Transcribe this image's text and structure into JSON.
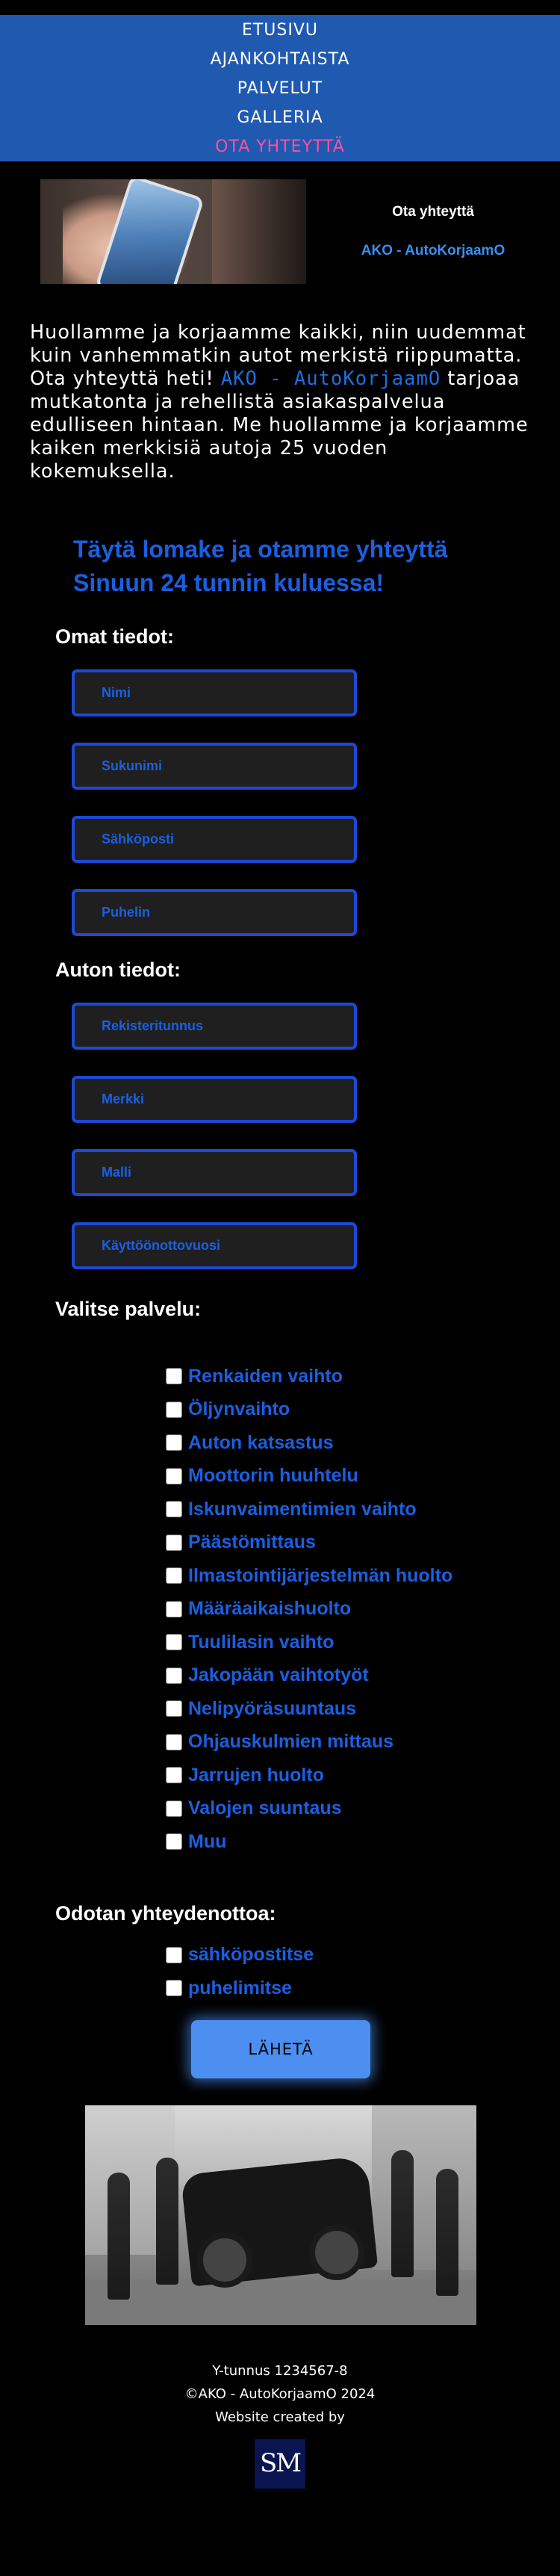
{
  "nav": {
    "items": [
      {
        "label": "ETUSIVU"
      },
      {
        "label": "AJANKOHTAISTA"
      },
      {
        "label": "PALVELUT"
      },
      {
        "label": "GALLERIA"
      },
      {
        "label": "OTA YHTEYTTÄ",
        "active": true
      }
    ],
    "active_color": "#ff4fa0",
    "background": "#2059b0"
  },
  "hero": {
    "contact_heading": "Ota yhteyttä",
    "contact_name": "AKO - AutoKorjaamO"
  },
  "intro": {
    "part1": "Huollamme ja korjaamme kaikki, niin uudemmat kuin vanhemmatkin autot merkistä riippumatta. Ota yhteyttä heti! ",
    "brand": "AKO - AutoKorjaamO",
    "part2": " tarjoaa mutkatonta ja rehellistä asiakaspalvelua edulliseen hintaan. Me huollamme ja korjaamme kaiken merkkisiä autoja 25 vuoden kokemuksella."
  },
  "form": {
    "title": "Täytä lomake ja otamme yhteyttä Sinuun 24 tunnin kuluessa!",
    "personal_heading": "Omat tiedot:",
    "personal_fields": [
      {
        "placeholder": "Nimi"
      },
      {
        "placeholder": "Sukunimi"
      },
      {
        "placeholder": "Sähköposti"
      },
      {
        "placeholder": "Puhelin"
      }
    ],
    "car_heading": "Auton tiedot:",
    "car_fields": [
      {
        "placeholder": "Rekisteritunnus"
      },
      {
        "placeholder": "Merkki"
      },
      {
        "placeholder": "Malli"
      },
      {
        "placeholder": "Käyttöönottovuosi"
      }
    ],
    "service_heading": "Valitse palvelu:",
    "services": [
      "Renkaiden vaihto",
      "Öljynvaihto",
      "Auton katsastus",
      "Moottorin huuhtelu",
      "Iskunvaimentimien vaihto",
      "Päästömittaus",
      "Ilmastointijärjestelmän huolto",
      "Määräaikaishuolto",
      "Tuulilasin vaihto",
      "Jakopään vaihtotyöt",
      "Nelipyöräsuuntaus",
      "Ohjauskulmien mittaus",
      "Jarrujen huolto",
      "Valojen suuntaus",
      "Muu"
    ],
    "contact_pref_heading": "Odotan yhteydenottoa:",
    "contact_prefs": [
      "sähköpostitse",
      "puhelimitse"
    ],
    "submit_label": "LÄHETÄ",
    "accent_color": "#1b5fe0"
  },
  "footer": {
    "business_id": "Y-tunnus 1234567-8",
    "copyright": "©AKO - AutoKorjaamO 2024",
    "credit": "Website created by",
    "logo_text": "SM"
  }
}
